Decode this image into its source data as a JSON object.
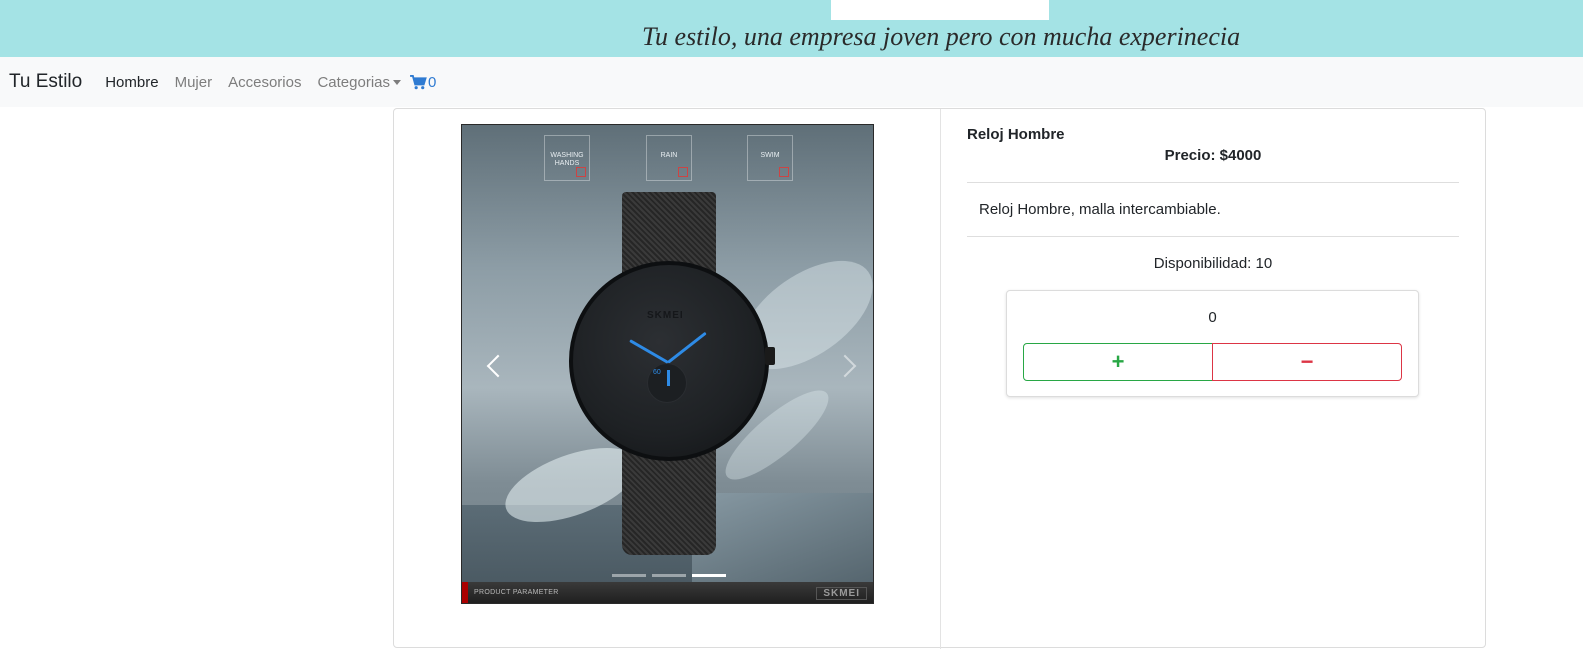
{
  "banner": {
    "slogan": "Tu estilo, una empresa joven pero con mucha experinecia",
    "color": "#a4e3e5"
  },
  "navbar": {
    "brand": "Tu Estilo",
    "links": [
      {
        "label": "Hombre",
        "active": true
      },
      {
        "label": "Mujer",
        "active": false
      },
      {
        "label": "Accesorios",
        "active": false
      },
      {
        "label": "Categorias",
        "active": false,
        "dropdown": true
      }
    ],
    "cart": {
      "icon": "cart-icon",
      "count": "0",
      "color": "#2f7bd2"
    }
  },
  "carousel": {
    "features": [
      "WASHING HANDS",
      "RAIN",
      "SWIM"
    ],
    "watch_brand": "SKMEI",
    "subdial_number": "60",
    "footer_text": "PRODUCT PARAMETER",
    "footer_brand": "SKMEI",
    "slides": 3,
    "active_slide": 3
  },
  "product": {
    "name": "Reloj Hombre",
    "price": "Precio: $4000",
    "description": "Reloj Hombre, malla intercambiable.",
    "availability": "Disponibilidad: 10"
  },
  "quantity": {
    "value": "0",
    "plus_label": "+",
    "minus_label": "−",
    "plus_color": "#28a745",
    "minus_color": "#dc3545"
  }
}
